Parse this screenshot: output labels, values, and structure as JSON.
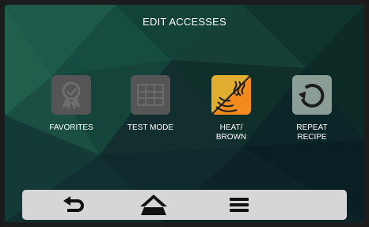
{
  "header": {
    "title": "EDIT ACCESSES"
  },
  "tiles": [
    {
      "label_line1": "FAVORITES",
      "label_line2": "",
      "icon": "favorites-ribbon-icon",
      "color": "#555555",
      "active": false
    },
    {
      "label_line1": "TEST MODE",
      "label_line2": "",
      "icon": "test-mode-grid-icon",
      "color": "#555555",
      "active": false
    },
    {
      "label_line1": "HEAT/",
      "label_line2": "BROWN",
      "icon": "heat-brown-icon",
      "color": "#f28a1e",
      "color2": "#e0ad30",
      "active": true
    },
    {
      "label_line1": "REPEAT",
      "label_line2": "RECIPE",
      "icon": "repeat-recipe-icon",
      "color": "#8a9e96",
      "active": true
    }
  ],
  "navbar": {
    "buttons": [
      {
        "icon": "back-arrow-icon"
      },
      {
        "icon": "home-icon"
      },
      {
        "icon": "menu-icon"
      }
    ]
  }
}
